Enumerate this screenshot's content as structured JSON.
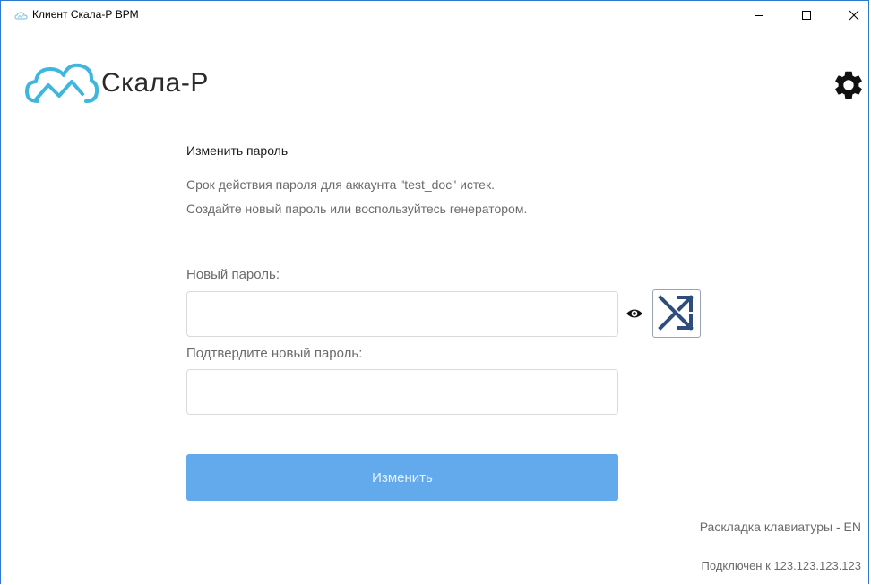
{
  "window": {
    "title": "Клиент Скала-Р ВРМ",
    "controls": [
      "minimize-icon",
      "maximize-icon",
      "close-icon"
    ]
  },
  "header": {
    "brand": "Скала-Р",
    "logo_icon": "cloud-logo-icon",
    "settings_icon": "gear-icon",
    "brand_color": "#3fb6de"
  },
  "form": {
    "heading": "Изменить пароль",
    "message_line1": "Срок действия пароля для аккаунта \"test_doc\" истек.",
    "message_line2": "Создайте новый пароль или воспользуйтесь генератором.",
    "new_password_label": "Новый пароль:",
    "new_password_value": "",
    "confirm_password_label": "Подтвердите новый пароль:",
    "confirm_password_value": "",
    "show_password_icon": "eye-icon",
    "generate_icon": "shuffle-icon",
    "submit_label": "Изменить",
    "submit_color": "#62aaeb"
  },
  "footer": {
    "keyboard_layout": "Раскладка клавиатуры -  EN",
    "connection": "Подключен к 123.123.123.123"
  }
}
